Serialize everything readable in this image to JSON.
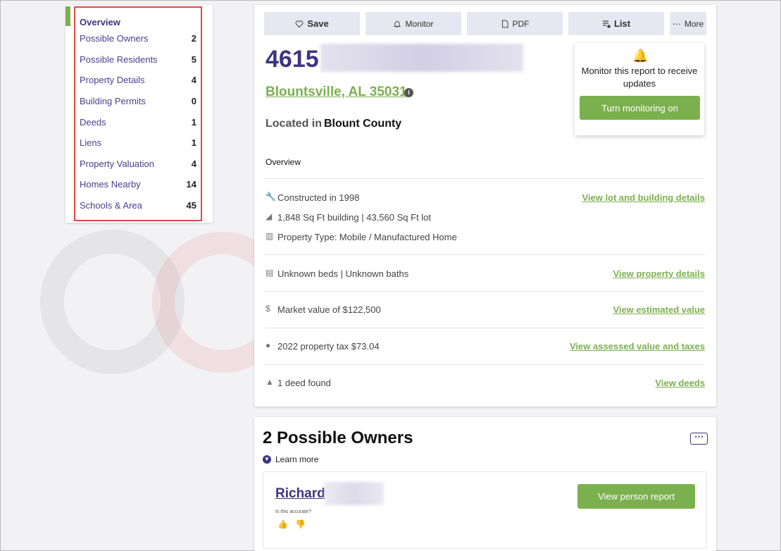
{
  "sidebar": {
    "items": [
      {
        "label": "Overview",
        "count": ""
      },
      {
        "label": "Possible Owners",
        "count": "2"
      },
      {
        "label": "Possible Residents",
        "count": "5"
      },
      {
        "label": "Property Details",
        "count": "4"
      },
      {
        "label": "Building Permits",
        "count": "0"
      },
      {
        "label": "Deeds",
        "count": "1"
      },
      {
        "label": "Liens",
        "count": "1"
      },
      {
        "label": "Property Valuation",
        "count": "4"
      },
      {
        "label": "Homes Nearby",
        "count": "14"
      },
      {
        "label": "Schools & Area",
        "count": "45"
      }
    ]
  },
  "toolbar": {
    "save": "Save",
    "monitor": "Monitor",
    "pdf": "PDF",
    "list": "List",
    "more": "More"
  },
  "report": {
    "address_number": "4615",
    "city": "Blountsville, AL 35031",
    "located_label": "Located in",
    "county": "Blount County",
    "overview_title": "Overview",
    "rows": [
      {
        "icon": "wrench-icon",
        "text": "Constructed in 1998",
        "link": "View lot and building details"
      },
      {
        "icon": "ruler-icon",
        "text": "1,848 Sq Ft building | 43,560 Sq Ft lot",
        "link": ""
      },
      {
        "icon": "building-icon",
        "text": "Property Type: Mobile / Manufactured Home",
        "link": ""
      },
      {
        "icon": "bed-icon",
        "text": "Unknown beds | Unknown baths",
        "link": "View property details"
      },
      {
        "icon": "dollar-icon",
        "text": "Market value of $122,500",
        "link": "View estimated value"
      },
      {
        "icon": "tax-icon",
        "text": "2022 property tax $73.04",
        "link": "View assessed value and taxes"
      },
      {
        "icon": "deed-icon",
        "text": "1 deed found",
        "link": "View deeds"
      }
    ]
  },
  "monitor_popup": {
    "message": "Monitor this report to receive updates",
    "button": "Turn monitoring on"
  },
  "owners": {
    "title": "2 Possible Owners",
    "learn_more": "Learn more",
    "person_name": "Richard",
    "accuracy_prompt": "Is this accurate?",
    "view_button": "View person report"
  },
  "colors": {
    "accent_green": "#7bb04f",
    "brand_purple": "#3c3580",
    "highlight_red": "#e04848"
  }
}
